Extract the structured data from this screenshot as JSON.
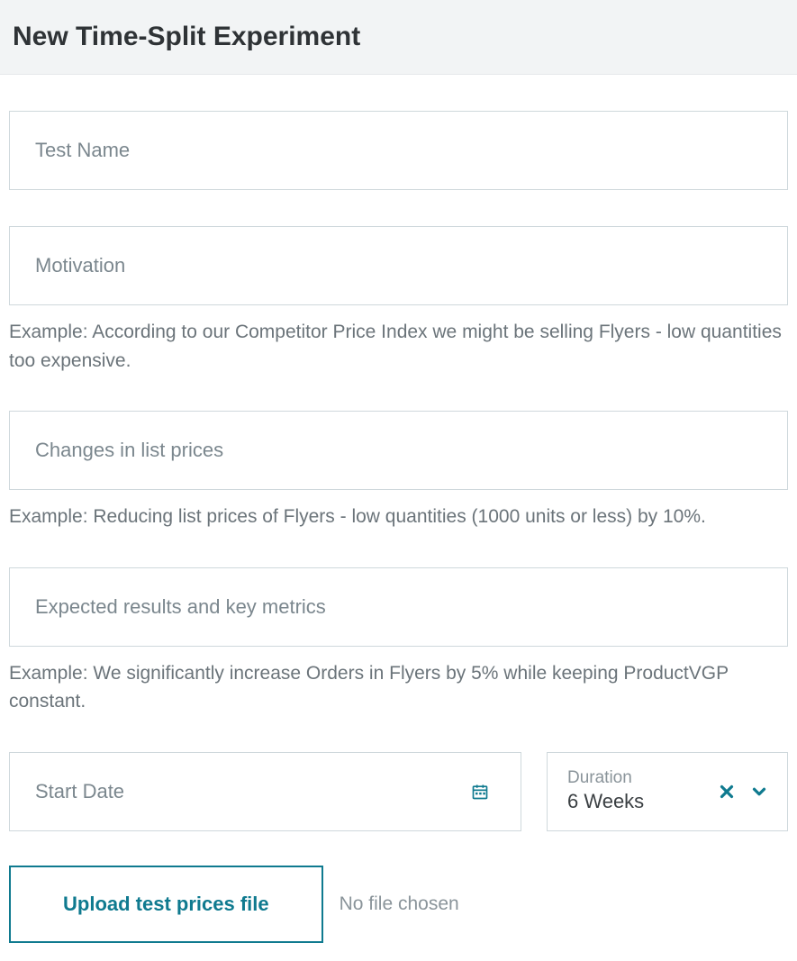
{
  "header": {
    "title": "New Time-Split Experiment"
  },
  "fields": {
    "test_name": {
      "placeholder": "Test Name"
    },
    "motivation": {
      "placeholder": "Motivation",
      "hint": "Example: According to our Competitor Price Index we might be selling Flyers - low quantities too expensive."
    },
    "changes": {
      "placeholder": "Changes in list prices",
      "hint": "Example: Reducing list prices of Flyers - low quantities (1000 units or less) by 10%."
    },
    "expected": {
      "placeholder": "Expected results and key metrics",
      "hint": "Example: We significantly increase Orders in Flyers by 5% while keeping ProductVGP constant."
    },
    "start_date": {
      "placeholder": "Start Date"
    },
    "duration": {
      "label": "Duration",
      "value": "6 Weeks"
    }
  },
  "upload": {
    "button": "Upload test prices file",
    "status": "No file chosen"
  },
  "colors": {
    "accent": "#0f7a8f"
  }
}
